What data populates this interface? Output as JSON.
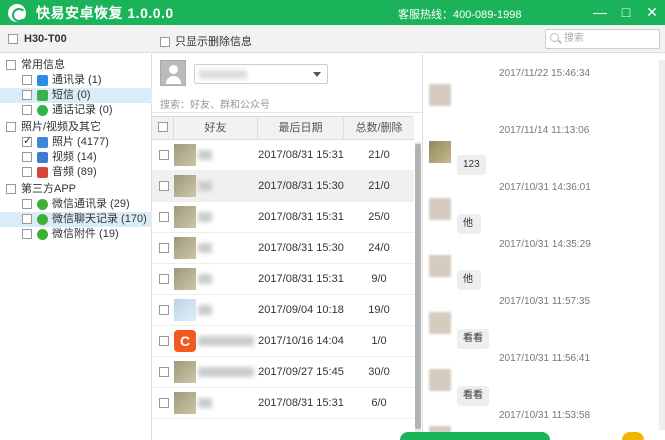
{
  "titlebar": {
    "title": "快易安卓恢复  1.0.0.0",
    "hotline": "客服热线：400-089-1998",
    "minimize": "—",
    "maximize": "□",
    "close": "✕"
  },
  "topbar": {
    "device": "H30-T00",
    "only_deleted": "只显示删除信息",
    "search_placeholder": "搜索"
  },
  "tree": {
    "groups": [
      {
        "label": "常用信息",
        "children": [
          {
            "label": "通讯录 (1)",
            "icon": "contacts-icon",
            "color": "#2d8ce6"
          },
          {
            "label": "短信 (0)",
            "icon": "sms-icon",
            "color": "#38b34a",
            "selected": true
          },
          {
            "label": "通话记录 (0)",
            "icon": "phone-icon",
            "color": "#2fb34a"
          }
        ]
      },
      {
        "label": "照片/视频及其它",
        "children": [
          {
            "label": "照片 (4177)",
            "icon": "photo-icon",
            "color": "#3b88d4",
            "checked": true
          },
          {
            "label": "视频 (14)",
            "icon": "video-icon",
            "color": "#3b7cd6"
          },
          {
            "label": "音频 (89)",
            "icon": "audio-icon",
            "color": "#d9443a"
          }
        ]
      },
      {
        "label": "第三方APP",
        "children": [
          {
            "label": "微信通讯录 (29)",
            "icon": "wechat-icon",
            "color": "#3cb034"
          },
          {
            "label": "微信聊天记录 (170)",
            "icon": "wechat-icon",
            "color": "#3cb034",
            "highlight": true
          },
          {
            "label": "微信附件 (19)",
            "icon": "wechat-icon",
            "color": "#3cb034"
          }
        ]
      }
    ]
  },
  "middle": {
    "search_placeholder": "搜索：好友、群和公众号",
    "headers": {
      "friend": "好友",
      "date": "最后日期",
      "count": "总数/删除"
    },
    "rows": [
      {
        "date": "2017/08/31 15:31",
        "count": "21/0",
        "thumb": "photo"
      },
      {
        "date": "2017/08/31 15:30",
        "count": "21/0",
        "thumb": "photo",
        "highlight": true
      },
      {
        "date": "2017/08/31 15:31",
        "count": "25/0",
        "thumb": "photo"
      },
      {
        "date": "2017/08/31 15:30",
        "count": "24/0",
        "thumb": "photo"
      },
      {
        "date": "2017/08/31 15:31",
        "count": "9/0",
        "thumb": "photo"
      },
      {
        "date": "2017/09/04 10:18",
        "count": "19/0",
        "thumb": "light"
      },
      {
        "date": "2017/10/16 14:04",
        "count": "1/0",
        "thumb": "orange"
      },
      {
        "date": "2017/09/27 15:45",
        "count": "30/0",
        "thumb": "photo"
      },
      {
        "date": "2017/08/31 15:31",
        "count": "6/0",
        "thumb": "photo"
      }
    ]
  },
  "chat": {
    "messages": [
      {
        "time": "2017/11/22 15:46:34",
        "bubble": ""
      },
      {
        "time": "2017/11/14 11:13:06",
        "bubble": "123"
      },
      {
        "time": "2017/10/31 14:36:01",
        "bubble": "他"
      },
      {
        "time": "2017/10/31 14:35:29",
        "bubble": "他"
      },
      {
        "time": "2017/10/31 11:57:35",
        "bubble": "看看"
      },
      {
        "time": "2017/10/31 11:56:41",
        "bubble": "看看"
      },
      {
        "time": "2017/10/31 11:53:58",
        "bubble": ""
      }
    ]
  }
}
